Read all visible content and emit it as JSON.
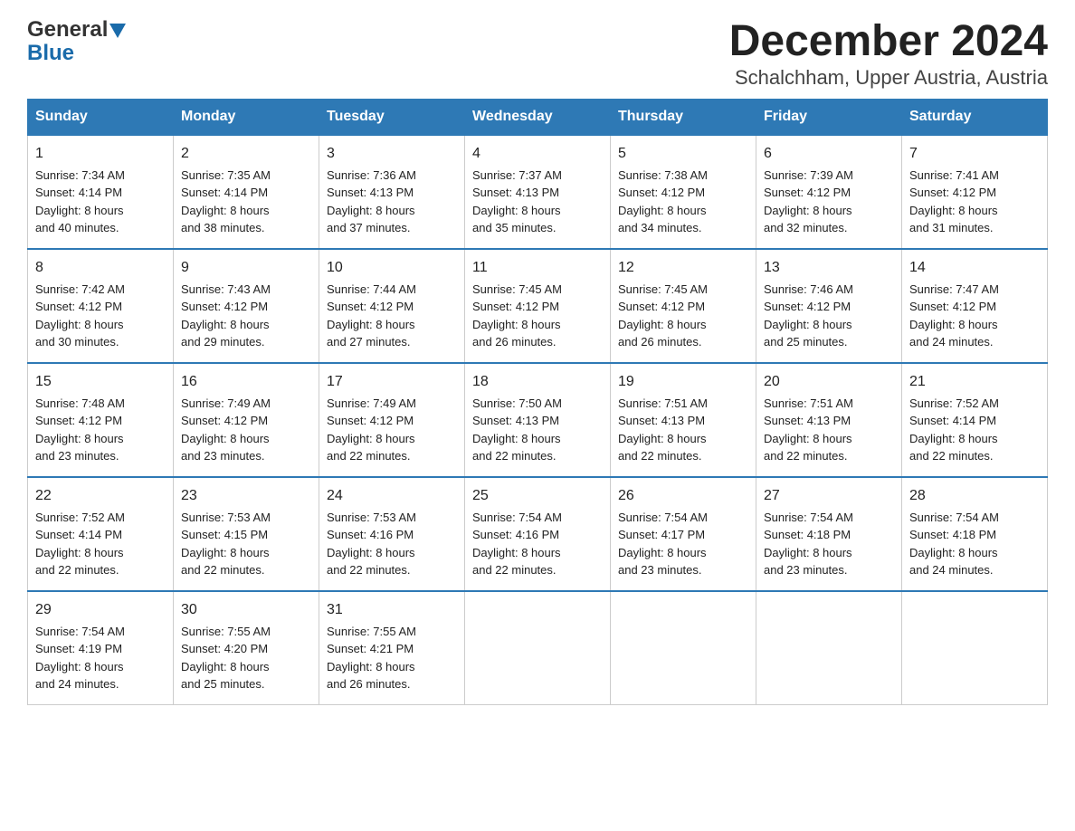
{
  "header": {
    "logo_general": "General",
    "logo_blue": "Blue",
    "title": "December 2024",
    "subtitle": "Schalchham, Upper Austria, Austria"
  },
  "days_of_week": [
    "Sunday",
    "Monday",
    "Tuesday",
    "Wednesday",
    "Thursday",
    "Friday",
    "Saturday"
  ],
  "weeks": [
    [
      {
        "day": "1",
        "sunrise": "7:34 AM",
        "sunset": "4:14 PM",
        "daylight": "8 hours and 40 minutes."
      },
      {
        "day": "2",
        "sunrise": "7:35 AM",
        "sunset": "4:14 PM",
        "daylight": "8 hours and 38 minutes."
      },
      {
        "day": "3",
        "sunrise": "7:36 AM",
        "sunset": "4:13 PM",
        "daylight": "8 hours and 37 minutes."
      },
      {
        "day": "4",
        "sunrise": "7:37 AM",
        "sunset": "4:13 PM",
        "daylight": "8 hours and 35 minutes."
      },
      {
        "day": "5",
        "sunrise": "7:38 AM",
        "sunset": "4:12 PM",
        "daylight": "8 hours and 34 minutes."
      },
      {
        "day": "6",
        "sunrise": "7:39 AM",
        "sunset": "4:12 PM",
        "daylight": "8 hours and 32 minutes."
      },
      {
        "day": "7",
        "sunrise": "7:41 AM",
        "sunset": "4:12 PM",
        "daylight": "8 hours and 31 minutes."
      }
    ],
    [
      {
        "day": "8",
        "sunrise": "7:42 AM",
        "sunset": "4:12 PM",
        "daylight": "8 hours and 30 minutes."
      },
      {
        "day": "9",
        "sunrise": "7:43 AM",
        "sunset": "4:12 PM",
        "daylight": "8 hours and 29 minutes."
      },
      {
        "day": "10",
        "sunrise": "7:44 AM",
        "sunset": "4:12 PM",
        "daylight": "8 hours and 27 minutes."
      },
      {
        "day": "11",
        "sunrise": "7:45 AM",
        "sunset": "4:12 PM",
        "daylight": "8 hours and 26 minutes."
      },
      {
        "day": "12",
        "sunrise": "7:45 AM",
        "sunset": "4:12 PM",
        "daylight": "8 hours and 26 minutes."
      },
      {
        "day": "13",
        "sunrise": "7:46 AM",
        "sunset": "4:12 PM",
        "daylight": "8 hours and 25 minutes."
      },
      {
        "day": "14",
        "sunrise": "7:47 AM",
        "sunset": "4:12 PM",
        "daylight": "8 hours and 24 minutes."
      }
    ],
    [
      {
        "day": "15",
        "sunrise": "7:48 AM",
        "sunset": "4:12 PM",
        "daylight": "8 hours and 23 minutes."
      },
      {
        "day": "16",
        "sunrise": "7:49 AM",
        "sunset": "4:12 PM",
        "daylight": "8 hours and 23 minutes."
      },
      {
        "day": "17",
        "sunrise": "7:49 AM",
        "sunset": "4:12 PM",
        "daylight": "8 hours and 22 minutes."
      },
      {
        "day": "18",
        "sunrise": "7:50 AM",
        "sunset": "4:13 PM",
        "daylight": "8 hours and 22 minutes."
      },
      {
        "day": "19",
        "sunrise": "7:51 AM",
        "sunset": "4:13 PM",
        "daylight": "8 hours and 22 minutes."
      },
      {
        "day": "20",
        "sunrise": "7:51 AM",
        "sunset": "4:13 PM",
        "daylight": "8 hours and 22 minutes."
      },
      {
        "day": "21",
        "sunrise": "7:52 AM",
        "sunset": "4:14 PM",
        "daylight": "8 hours and 22 minutes."
      }
    ],
    [
      {
        "day": "22",
        "sunrise": "7:52 AM",
        "sunset": "4:14 PM",
        "daylight": "8 hours and 22 minutes."
      },
      {
        "day": "23",
        "sunrise": "7:53 AM",
        "sunset": "4:15 PM",
        "daylight": "8 hours and 22 minutes."
      },
      {
        "day": "24",
        "sunrise": "7:53 AM",
        "sunset": "4:16 PM",
        "daylight": "8 hours and 22 minutes."
      },
      {
        "day": "25",
        "sunrise": "7:54 AM",
        "sunset": "4:16 PM",
        "daylight": "8 hours and 22 minutes."
      },
      {
        "day": "26",
        "sunrise": "7:54 AM",
        "sunset": "4:17 PM",
        "daylight": "8 hours and 23 minutes."
      },
      {
        "day": "27",
        "sunrise": "7:54 AM",
        "sunset": "4:18 PM",
        "daylight": "8 hours and 23 minutes."
      },
      {
        "day": "28",
        "sunrise": "7:54 AM",
        "sunset": "4:18 PM",
        "daylight": "8 hours and 24 minutes."
      }
    ],
    [
      {
        "day": "29",
        "sunrise": "7:54 AM",
        "sunset": "4:19 PM",
        "daylight": "8 hours and 24 minutes."
      },
      {
        "day": "30",
        "sunrise": "7:55 AM",
        "sunset": "4:20 PM",
        "daylight": "8 hours and 25 minutes."
      },
      {
        "day": "31",
        "sunrise": "7:55 AM",
        "sunset": "4:21 PM",
        "daylight": "8 hours and 26 minutes."
      },
      null,
      null,
      null,
      null
    ]
  ],
  "labels": {
    "sunrise": "Sunrise:",
    "sunset": "Sunset:",
    "daylight": "Daylight:"
  }
}
